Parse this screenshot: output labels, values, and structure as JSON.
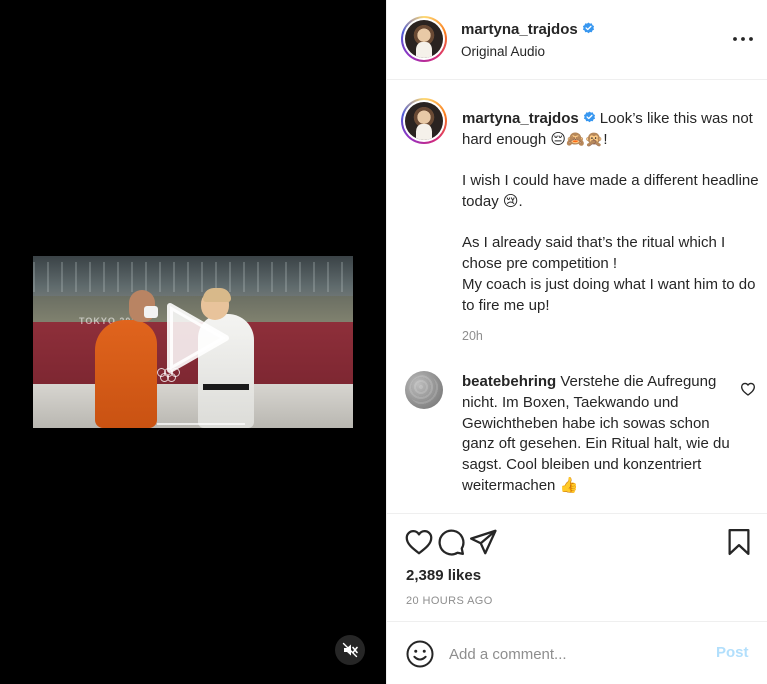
{
  "author": {
    "username": "martyna_trajdos",
    "audio": "Original Audio",
    "verified": true
  },
  "caption": {
    "username": "martyna_trajdos",
    "paragraphs": [
      "Look’s like this was not hard enough 😔🙈🙊!",
      "I wish I could have made a different headline today 😢.",
      "As I already said that’s the ritual which I chose pre competition !",
      "My coach is just doing what I want him to do to fire me up!"
    ],
    "time": "20h"
  },
  "comments": [
    {
      "username": "beatebehring",
      "text": "Verstehe die Aufregung nicht. Im Boxen, Taekwando und Gewichtheben habe ich sowas schon ganz oft gesehen. Ein Ritual halt, wie du sagst. Cool bleiben und konzentriert weitermachen 👍"
    }
  ],
  "video": {
    "overlay_text": "TOKYO 2020",
    "muted": true
  },
  "actions": {
    "likes": "2,389 likes",
    "posted": "20 HOURS AGO"
  },
  "comment_box": {
    "placeholder": "Add a comment...",
    "post_label": "Post"
  },
  "icons": {
    "more": "more-options-icon",
    "like": "heart-icon",
    "comment": "comment-icon",
    "share": "paper-plane-icon",
    "save": "bookmark-icon",
    "emoji": "emoji-icon",
    "play": "play-icon",
    "mute": "muted-speaker-icon",
    "verified": "verified-badge-icon"
  },
  "colors": {
    "verified": "#3897f0",
    "text": "#262626",
    "muted_text": "#8e8e8e",
    "post_button": "#b2dffc"
  }
}
